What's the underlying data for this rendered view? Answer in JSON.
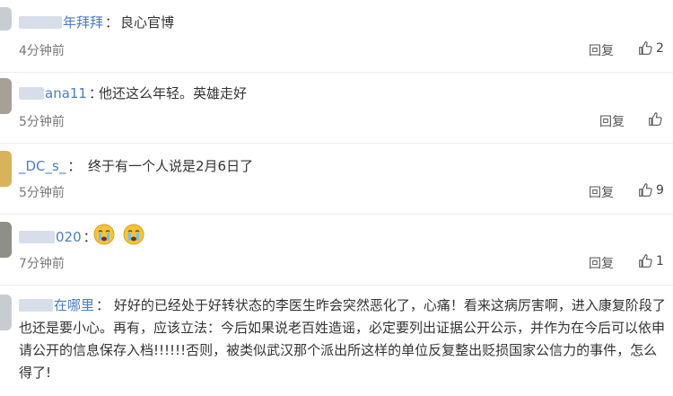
{
  "comments": [
    {
      "username": "年拜拜",
      "text": "良心官博",
      "time": "4分钟前",
      "reply": "回复",
      "likes": "2"
    },
    {
      "username": "ana11",
      "text": "他还这么年轻。英雄走好",
      "time": "5分钟前",
      "reply": "回复",
      "likes": ""
    },
    {
      "username": "_DC_s_",
      "text": "终于有一个人说是2月6日了",
      "time": "5分钟前",
      "reply": "回复",
      "likes": "9"
    },
    {
      "username": "020",
      "text": "",
      "emoji": "crying-face-icon",
      "time": "7分钟前",
      "reply": "回复",
      "likes": "1"
    },
    {
      "username": "在哪里",
      "text": "好好的已经处于好转状态的李医生昨会突然恶化了，心痛！看来这病厉害啊，进入康复阶段了也还是要小心。再有，应该立法：今后如果说老百姓造谣，必定要列出证据公开公示，并作为在今后可以依申请公开的信息保存入档!!!!!!否则，被类似武汉那个派出所这样的单位反复整出贬损国家公信力的事件，怎么得了!"
    }
  ],
  "colors": {
    "username": "#4a7dc4",
    "text": "#333333",
    "meta": "#777777",
    "emoji": "#f5c33b"
  }
}
